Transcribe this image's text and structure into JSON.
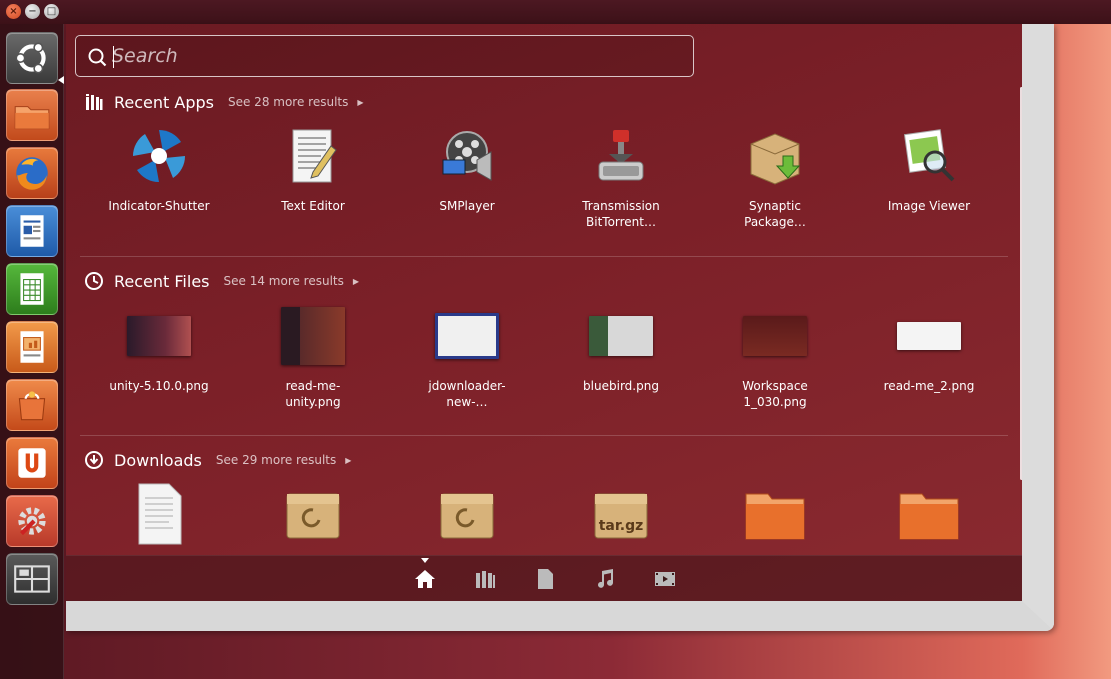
{
  "window_controls": {
    "close": "×",
    "minimize": "−",
    "maximize": "□"
  },
  "search": {
    "placeholder": "Search",
    "value": ""
  },
  "sections": [
    {
      "title": "Recent Apps",
      "see_more": "See 28 more results",
      "icon": "apps-icon",
      "items": [
        {
          "label": "Indicator-Shutter",
          "icon": "shutter-app-icon"
        },
        {
          "label": "Text Editor",
          "icon": "text-editor-app-icon"
        },
        {
          "label": "SMPlayer",
          "icon": "smplayer-app-icon"
        },
        {
          "label": "Transmission BitTorrent…",
          "icon": "transmission-app-icon"
        },
        {
          "label": "Synaptic Package…",
          "icon": "synaptic-app-icon"
        },
        {
          "label": "Image Viewer",
          "icon": "image-viewer-app-icon"
        }
      ]
    },
    {
      "title": "Recent Files",
      "see_more": "See 14 more results",
      "icon": "clock-icon",
      "items": [
        {
          "label": "unity-5.10.0.png",
          "icon": "image-thumbnail"
        },
        {
          "label": "read-me-unity.png",
          "icon": "image-thumbnail"
        },
        {
          "label": "jdownloader-new-…",
          "icon": "image-thumbnail"
        },
        {
          "label": "bluebird.png",
          "icon": "image-thumbnail"
        },
        {
          "label": "Workspace 1_030.png",
          "icon": "image-thumbnail"
        },
        {
          "label": "read-me_2.png",
          "icon": "image-thumbnail"
        }
      ]
    },
    {
      "title": "Downloads",
      "see_more": "See 29 more results",
      "icon": "download-icon",
      "items": [
        {
          "label": "",
          "icon": "text-document-icon"
        },
        {
          "label": "",
          "icon": "deb-package-icon"
        },
        {
          "label": "",
          "icon": "deb-package-icon"
        },
        {
          "label": "tar.gz",
          "icon": "archive-icon"
        },
        {
          "label": "",
          "icon": "folder-icon"
        },
        {
          "label": "",
          "icon": "folder-icon"
        }
      ]
    }
  ],
  "launcher": [
    "dash-home-icon",
    "files-icon",
    "firefox-icon",
    "writer-icon",
    "calc-icon",
    "impress-icon",
    "software-center-icon",
    "ubuntu-one-icon",
    "settings-icon",
    "workspaces-icon"
  ],
  "lenses": [
    "home-lens-icon",
    "applications-lens-icon",
    "files-lens-icon",
    "music-lens-icon",
    "video-lens-icon"
  ],
  "colors": {
    "panel": "#7c2028",
    "launcher_bg": "#3c1118",
    "accent": "#dd4814"
  }
}
